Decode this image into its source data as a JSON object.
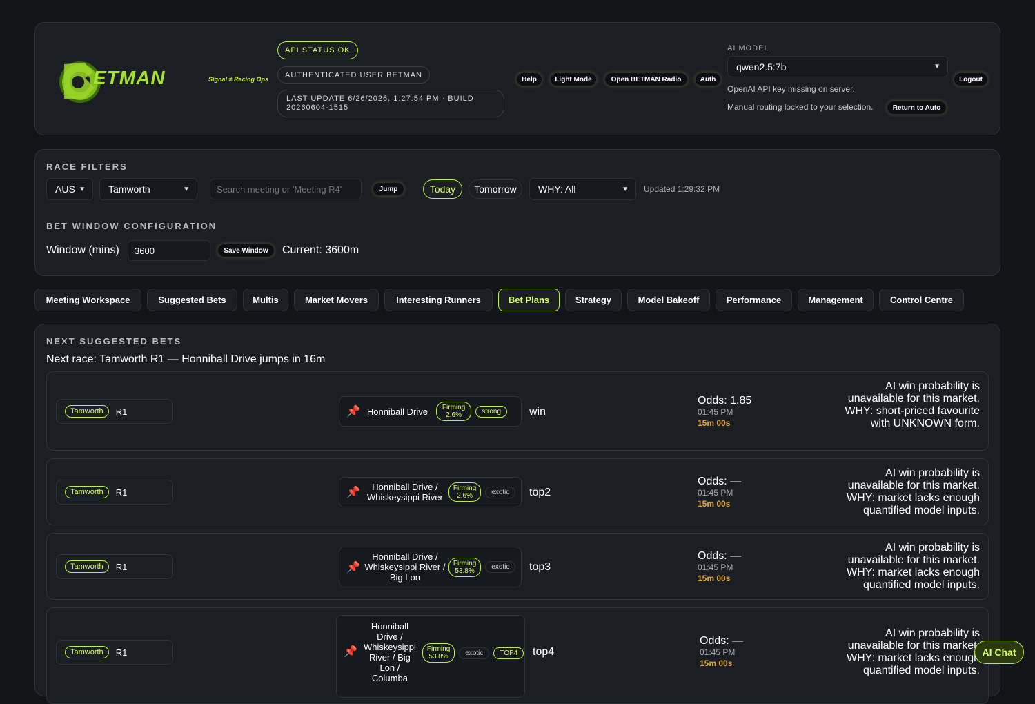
{
  "header": {
    "logo_text": "ETMAN",
    "tagline": "Signal ≠ Racing Ops",
    "api_status": "API STATUS OK",
    "auth_user": "AUTHENTICATED USER BETMAN",
    "last_update": "LAST UPDATE 6/26/2026, 1:27:54 PM · BUILD 20260604-1515",
    "buttons": {
      "help": "Help",
      "light_mode": "Light Mode",
      "radio": "Open BETMAN Radio",
      "auth": "Auth",
      "logout": "Logout"
    },
    "ai_model_label": "AI MODEL",
    "ai_model_value": "qwen2.5:7b",
    "api_key_warning": "OpenAI API key missing on server.",
    "routing_note": "Manual routing locked to your selection.",
    "return_auto": "Return to Auto"
  },
  "filters": {
    "title": "RACE FILTERS",
    "country": "AUS",
    "meeting": "Tamworth",
    "search_placeholder": "Search meeting or 'Meeting R4'",
    "jump": "Jump",
    "today": "Today",
    "tomorrow": "Tomorrow",
    "why": "WHY: All",
    "updated": "Updated 1:29:32 PM"
  },
  "bet_window": {
    "title": "BET WINDOW CONFIGURATION",
    "label": "Window (mins)",
    "value": "3600",
    "save": "Save Window",
    "current": "Current: 3600m"
  },
  "tabs": [
    "Meeting Workspace",
    "Suggested Bets",
    "Multis",
    "Market Movers",
    "Interesting Runners",
    "Bet Plans",
    "Strategy",
    "Model Bakeoff",
    "Performance",
    "Management",
    "Control Centre"
  ],
  "active_tab": "Bet Plans",
  "next_bets": {
    "title": "NEXT SUGGESTED BETS",
    "subtitle": "Next race: Tamworth R1 — Honniball Drive jumps in 16m",
    "rows": [
      {
        "venue": "Tamworth",
        "race": "R1",
        "runner": "Honniball Drive",
        "firm": "Firming",
        "firm_pct": "2.6%",
        "tag": "strong",
        "tag2": "",
        "type": "win",
        "odds": "Odds: 1.85",
        "time": "01:45 PM",
        "countdown": "15m 00s",
        "why": "AI win probability is unavailable for this market. WHY: short-priced favourite with UNKNOWN form."
      },
      {
        "venue": "Tamworth",
        "race": "R1",
        "runner": "Honniball Drive / Whiskeysippi River",
        "firm": "Firming",
        "firm_pct": "2.6%",
        "tag": "exotic",
        "tag2": "",
        "type": "top2",
        "odds": "Odds: —",
        "time": "01:45 PM",
        "countdown": "15m 00s",
        "why": "AI win probability is unavailable for this market. WHY: market lacks enough quantified model inputs."
      },
      {
        "venue": "Tamworth",
        "race": "R1",
        "runner": "Honniball Drive / Whiskeysippi River / Big Lon",
        "firm": "Firming",
        "firm_pct": "53.8%",
        "tag": "exotic",
        "tag2": "",
        "type": "top3",
        "odds": "Odds: —",
        "time": "01:45 PM",
        "countdown": "15m 00s",
        "why": "AI win probability is unavailable for this market. WHY: market lacks enough quantified model inputs."
      },
      {
        "venue": "Tamworth",
        "race": "R1",
        "runner": "Honniball Drive / Whiskeysippi River / Big Lon / Columba",
        "firm": "Firming",
        "firm_pct": "53.8%",
        "tag": "exotic",
        "tag2": "TOP4",
        "type": "top4",
        "odds": "Odds: —",
        "time": "01:45 PM",
        "countdown": "15m 00s",
        "why": "AI win probability is unavailable for this market. WHY: market lacks enough quantified model inputs."
      }
    ]
  },
  "ai_chat": "AI Chat"
}
